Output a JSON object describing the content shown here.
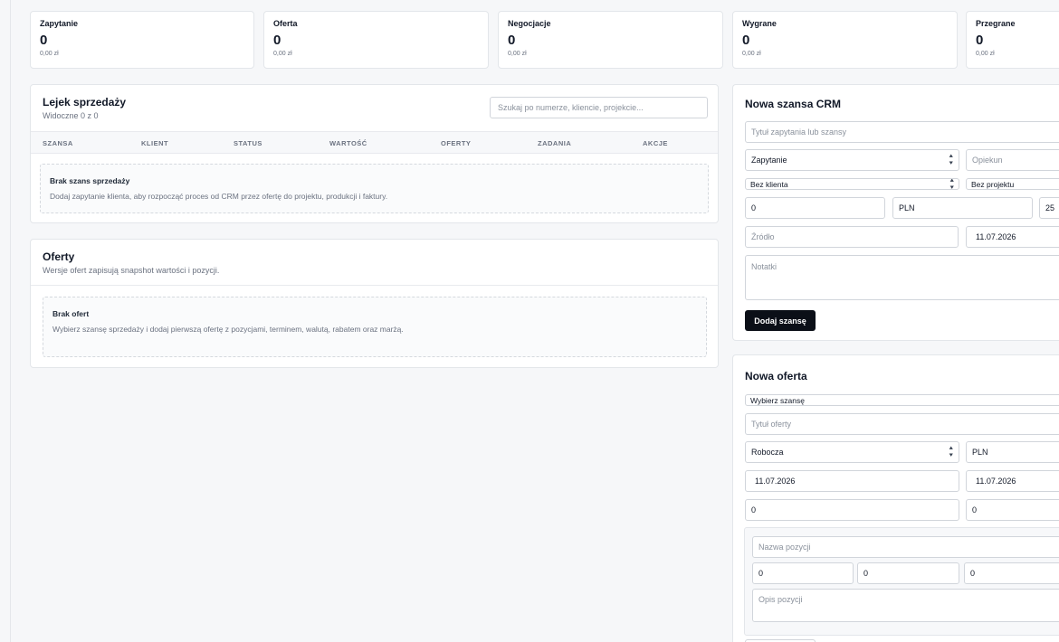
{
  "stats": [
    {
      "label": "Zapytanie",
      "count": "0",
      "amount": "0,00 zł"
    },
    {
      "label": "Oferta",
      "count": "0",
      "amount": "0,00 zł"
    },
    {
      "label": "Negocjacje",
      "count": "0",
      "amount": "0,00 zł"
    },
    {
      "label": "Wygrane",
      "count": "0",
      "amount": "0,00 zł"
    },
    {
      "label": "Przegrane",
      "count": "0",
      "amount": "0,00 zł"
    }
  ],
  "pipeline": {
    "title": "Lejek sprzedaży",
    "subtitle": "Widoczne 0 z 0",
    "search_placeholder": "Szukaj po numerze, kliencie, projekcie...",
    "columns": [
      "SZANSA",
      "KLIENT",
      "STATUS",
      "WARTOŚĆ",
      "OFERTY",
      "ZADANIA",
      "AKCJE"
    ],
    "empty_title": "Brak szans sprzedaży",
    "empty_text": "Dodaj zapytanie klienta, aby rozpocząć proces od CRM przez ofertę do projektu, produkcji i faktury."
  },
  "offers": {
    "title": "Oferty",
    "subtitle": "Wersje ofert zapisują snapshot wartości i pozycji.",
    "empty_title": "Brak ofert",
    "empty_text": "Wybierz szansę sprzedaży i dodaj pierwszą ofertę z pozycjami, terminem, walutą, rabatem oraz marżą."
  },
  "new_opportunity": {
    "title": "Nowa szansa CRM",
    "title_placeholder": "Tytuł zapytania lub szansy",
    "stage": "Zapytanie",
    "owner_placeholder": "Opiekun",
    "client": "Bez klienta",
    "project": "Bez projektu",
    "value": "0",
    "currency": "PLN",
    "probability": "25",
    "source_placeholder": "Źródło",
    "date": "11.07.2026",
    "notes_placeholder": "Notatki",
    "submit": "Dodaj szansę"
  },
  "new_offer": {
    "title": "Nowa oferta",
    "opportunity_select": "Wybierz szansę",
    "title_placeholder": "Tytuł oferty",
    "status": "Robocza",
    "currency": "PLN",
    "date_from": "11.07.2026",
    "date_to": "11.07.2026",
    "discount": "0",
    "margin": "0",
    "item_name_placeholder": "Nazwa pozycji",
    "item_qty": "0",
    "item_price": "0",
    "item_vat": "0",
    "item_desc_placeholder": "Opis pozycji"
  }
}
